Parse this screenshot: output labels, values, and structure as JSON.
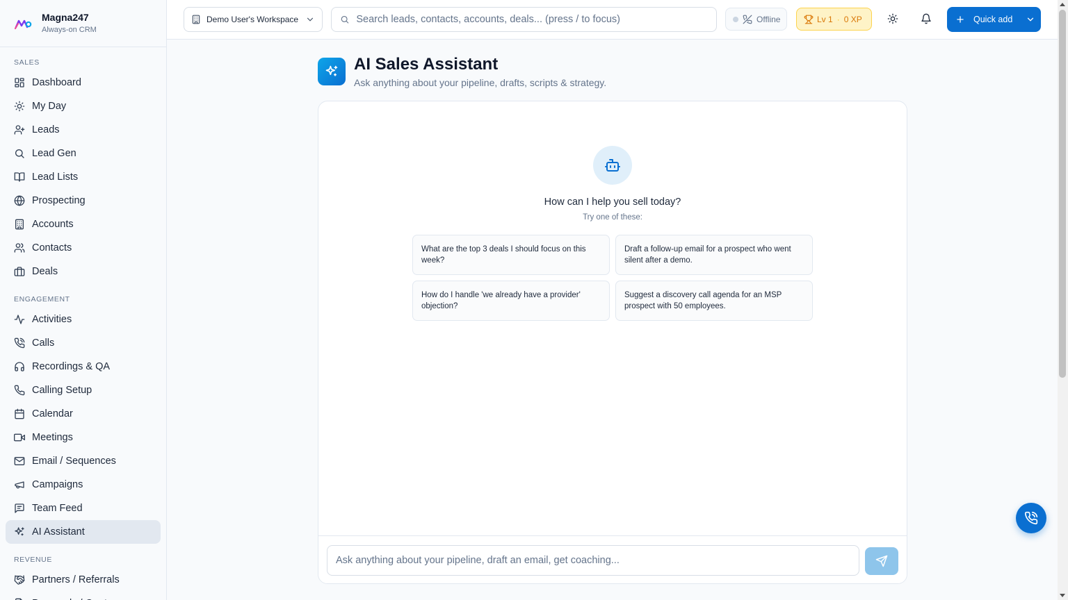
{
  "app": {
    "name": "Magna247",
    "tagline": "Always-on CRM"
  },
  "sidebar": {
    "sections": [
      {
        "title": "SALES",
        "items": [
          {
            "label": "Dashboard",
            "icon": "dashboard-icon"
          },
          {
            "label": "My Day",
            "icon": "sun-icon"
          },
          {
            "label": "Leads",
            "icon": "user-plus-icon"
          },
          {
            "label": "Lead Gen",
            "icon": "search-icon"
          },
          {
            "label": "Lead Lists",
            "icon": "book-open-icon"
          },
          {
            "label": "Prospecting",
            "icon": "globe-icon"
          },
          {
            "label": "Accounts",
            "icon": "building-icon"
          },
          {
            "label": "Contacts",
            "icon": "users-icon"
          },
          {
            "label": "Deals",
            "icon": "briefcase-icon"
          }
        ]
      },
      {
        "title": "ENGAGEMENT",
        "items": [
          {
            "label": "Activities",
            "icon": "activity-icon"
          },
          {
            "label": "Calls",
            "icon": "phone-call-icon"
          },
          {
            "label": "Recordings & QA",
            "icon": "headphones-icon"
          },
          {
            "label": "Calling Setup",
            "icon": "phone-icon"
          },
          {
            "label": "Calendar",
            "icon": "calendar-icon"
          },
          {
            "label": "Meetings",
            "icon": "video-icon"
          },
          {
            "label": "Email / Sequences",
            "icon": "mail-icon"
          },
          {
            "label": "Campaigns",
            "icon": "megaphone-icon"
          },
          {
            "label": "Team Feed",
            "icon": "message-square-icon"
          },
          {
            "label": "AI Assistant",
            "icon": "sparkles-icon",
            "active": true
          }
        ]
      },
      {
        "title": "REVENUE",
        "items": [
          {
            "label": "Partners / Referrals",
            "icon": "handshake-icon"
          },
          {
            "label": "Proposals / Quotes",
            "icon": "file-text-icon"
          }
        ]
      }
    ]
  },
  "topbar": {
    "workspace": "Demo User's Workspace",
    "search_placeholder": "Search leads, contacts, accounts, deals... (press / to focus)",
    "status": "Offline",
    "level": "Lv 1",
    "xp": "0 XP",
    "quick_add": "Quick add"
  },
  "page": {
    "title": "AI Sales Assistant",
    "subtitle": "Ask anything about your pipeline, drafts, scripts & strategy."
  },
  "assistant": {
    "empty_title": "How can I help you sell today?",
    "empty_subtitle": "Try one of these:",
    "suggestions": [
      "What are the top 3 deals I should focus on this week?",
      "Draft a follow-up email for a prospect who went silent after a demo.",
      "How do I handle 'we already have a provider' objection?",
      "Suggest a discovery call agenda for an MSP prospect with 50 employees."
    ],
    "input_placeholder": "Ask anything about your pipeline, draft an email, get coaching..."
  },
  "colors": {
    "primary": "#0a6fd1",
    "active_nav": "#e2e8f0",
    "xp_bg": "#fef3c7",
    "send_disabled": "#8ec5eb"
  }
}
